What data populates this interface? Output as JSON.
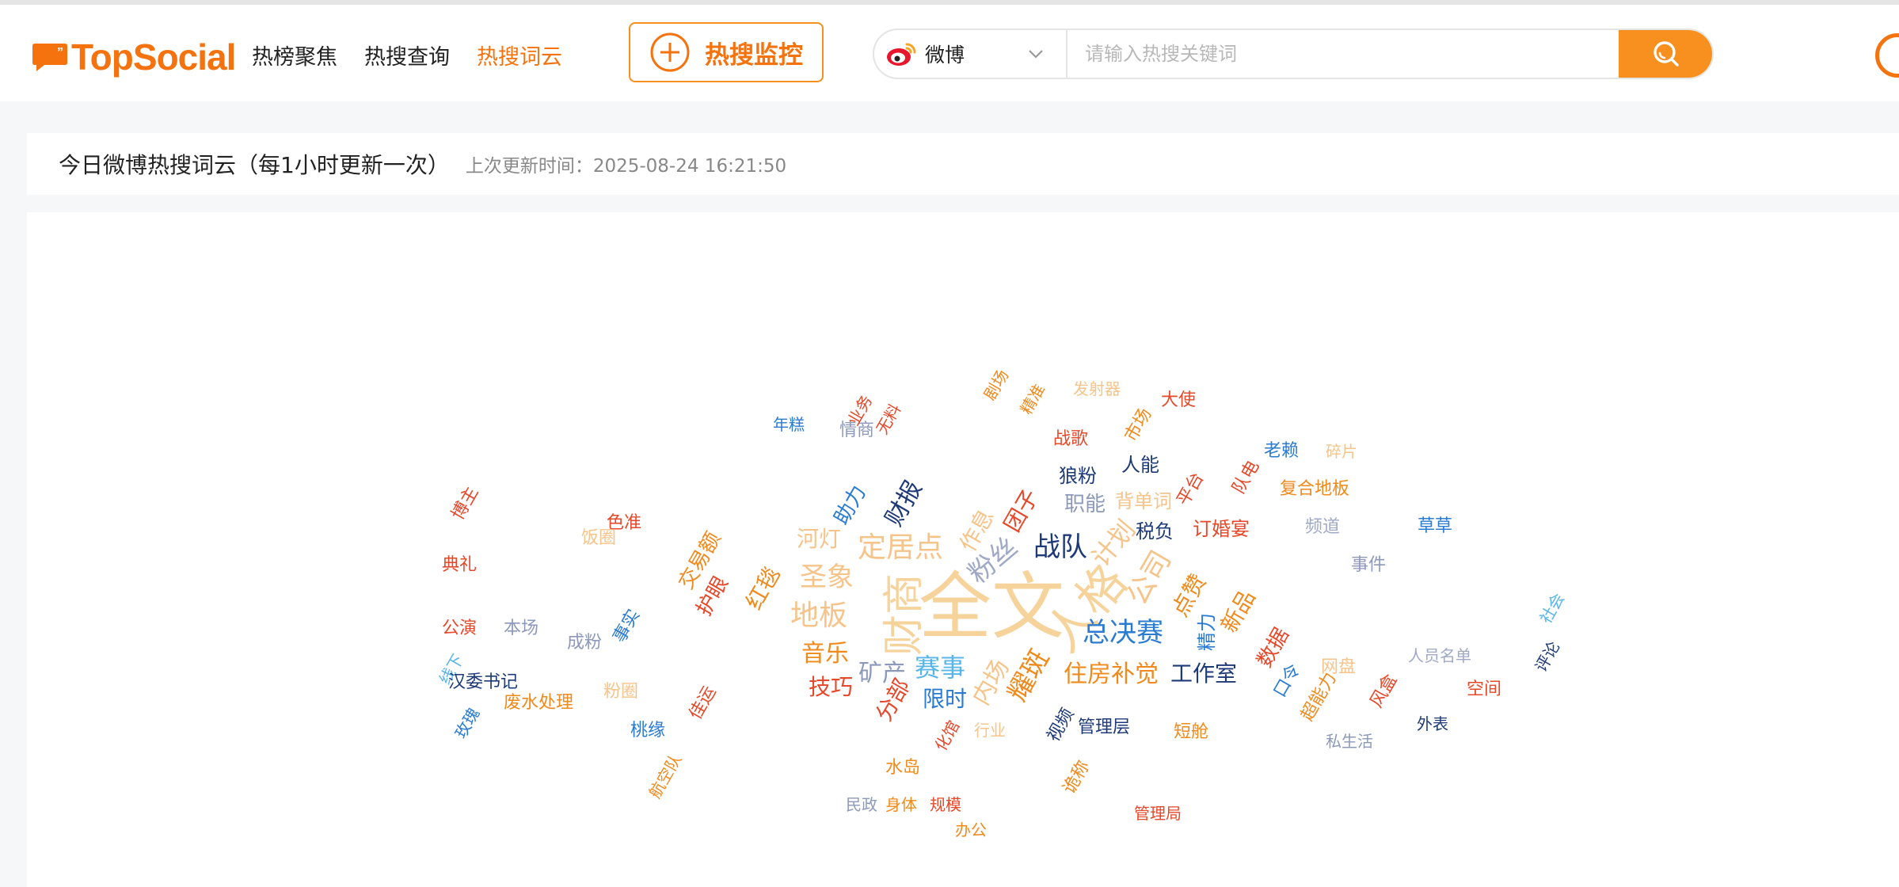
{
  "header": {
    "logo_text": "TopSocial",
    "nav": [
      {
        "label": "热榜聚焦",
        "active": false
      },
      {
        "label": "热搜查询",
        "active": false
      },
      {
        "label": "热搜词云",
        "active": true
      }
    ],
    "monitor_button": "热搜监控",
    "search": {
      "platform": "微博",
      "placeholder": "请输入热搜关键词",
      "value": ""
    }
  },
  "panel": {
    "title": "今日微博热搜词云（每1小时更新一次）",
    "updated": "上次更新时间：2025-08-24 16:21:50"
  },
  "colors": {
    "brand": "#f5730f",
    "accent": "#f7901e"
  },
  "cloud_words": [
    {
      "t": "全文",
      "c": "#f7d39c"
    },
    {
      "t": "财商",
      "c": "#f7d39c"
    },
    {
      "t": "人格",
      "c": "#f7d39c"
    },
    {
      "t": "地板",
      "c": "#f6c48a"
    },
    {
      "t": "圣象",
      "c": "#f6c48a"
    },
    {
      "t": "定居点",
      "c": "#f6c48a"
    },
    {
      "t": "粉丝",
      "c": "#9fa9c6"
    },
    {
      "t": "作息",
      "c": "#f6c48a"
    },
    {
      "t": "战队",
      "c": "#1e3a78"
    },
    {
      "t": "公司",
      "c": "#f6c48a"
    },
    {
      "t": "计划",
      "c": "#f6c48a"
    },
    {
      "t": "总决赛",
      "c": "#2a7bd2"
    },
    {
      "t": "住房补觉",
      "c": "#f08a1d"
    },
    {
      "t": "工作室",
      "c": "#1e3a78"
    },
    {
      "t": "耀斑",
      "c": "#f08a1d"
    },
    {
      "t": "内场",
      "c": "#f6c48a"
    },
    {
      "t": "赛事",
      "c": "#58b5e8"
    },
    {
      "t": "矿产",
      "c": "#8c99bb"
    },
    {
      "t": "音乐",
      "c": "#f08a1d"
    },
    {
      "t": "技巧",
      "c": "#e6482a"
    },
    {
      "t": "限时",
      "c": "#2a7bd2"
    },
    {
      "t": "分部",
      "c": "#e6482a"
    },
    {
      "t": "河灯",
      "c": "#f6c48a"
    },
    {
      "t": "团子",
      "c": "#e6482a"
    },
    {
      "t": "财报",
      "c": "#1e3a78"
    },
    {
      "t": "助力",
      "c": "#2a7bd2"
    },
    {
      "t": "红毯",
      "c": "#f08a1d"
    },
    {
      "t": "护眼",
      "c": "#e6482a"
    },
    {
      "t": "交易额",
      "c": "#f08a1d"
    },
    {
      "t": "点赞",
      "c": "#f08a1d"
    },
    {
      "t": "精力",
      "c": "#2a7bd2"
    },
    {
      "t": "新品",
      "c": "#f08a1d"
    },
    {
      "t": "数据",
      "c": "#e6482a"
    },
    {
      "t": "职能",
      "c": "#8c99bb"
    },
    {
      "t": "狼粉",
      "c": "#1e3a78"
    },
    {
      "t": "人能",
      "c": "#1e3a78"
    },
    {
      "t": "税负",
      "c": "#1e3a78"
    },
    {
      "t": "订婚宴",
      "c": "#e6482a"
    },
    {
      "t": "复合地板",
      "c": "#f08a1d"
    },
    {
      "t": "老赖",
      "c": "#2a7bd2"
    },
    {
      "t": "碎片",
      "c": "#f6c48a"
    },
    {
      "t": "大使",
      "c": "#e6482a"
    },
    {
      "t": "发射器",
      "c": "#f6c48a"
    },
    {
      "t": "背单词",
      "c": "#f6c48a"
    },
    {
      "t": "平台",
      "c": "#e6482a"
    },
    {
      "t": "队电",
      "c": "#e6482a"
    },
    {
      "t": "频道",
      "c": "#9fa9c6"
    },
    {
      "t": "草草",
      "c": "#2a7bd2"
    },
    {
      "t": "事件",
      "c": "#8c99bb"
    },
    {
      "t": "人员名单",
      "c": "#9fa9c6"
    },
    {
      "t": "空间",
      "c": "#e6482a"
    },
    {
      "t": "评论",
      "c": "#1e3a78"
    },
    {
      "t": "社会",
      "c": "#58b5e8"
    },
    {
      "t": "网盘",
      "c": "#f6c48a"
    },
    {
      "t": "口令",
      "c": "#2a7bd2"
    },
    {
      "t": "超能力",
      "c": "#f08a1d"
    },
    {
      "t": "风盒",
      "c": "#e6482a"
    },
    {
      "t": "外表",
      "c": "#1e3a78"
    },
    {
      "t": "私生活",
      "c": "#8c99bb"
    },
    {
      "t": "短舱",
      "c": "#f08a1d"
    },
    {
      "t": "管理局",
      "c": "#e6482a"
    },
    {
      "t": "管理层",
      "c": "#1e3a78"
    },
    {
      "t": "视频",
      "c": "#1e3a78"
    },
    {
      "t": "诡称",
      "c": "#f08a1d"
    },
    {
      "t": "规模",
      "c": "#e6482a"
    },
    {
      "t": "身体",
      "c": "#f08a1d"
    },
    {
      "t": "民政",
      "c": "#8c99bb"
    },
    {
      "t": "办公",
      "c": "#f08a1d"
    },
    {
      "t": "水岛",
      "c": "#f08a1d"
    },
    {
      "t": "行业",
      "c": "#f6c48a"
    },
    {
      "t": "化馆",
      "c": "#e6482a"
    },
    {
      "t": "桃缘",
      "c": "#2a7bd2"
    },
    {
      "t": "航空队",
      "c": "#f08a1d"
    },
    {
      "t": "粉圈",
      "c": "#f6c48a"
    },
    {
      "t": "佳运",
      "c": "#e6482a"
    },
    {
      "t": "事实",
      "c": "#2a7bd2"
    },
    {
      "t": "成粉",
      "c": "#8c99bb"
    },
    {
      "t": "本场",
      "c": "#8c99bb"
    },
    {
      "t": "公演",
      "c": "#e6482a"
    },
    {
      "t": "线下",
      "c": "#58b5e8"
    },
    {
      "t": "典礼",
      "c": "#e6482a"
    },
    {
      "t": "博主",
      "c": "#e6482a"
    },
    {
      "t": "色准",
      "c": "#e6482a"
    },
    {
      "t": "饭圈",
      "c": "#f6c48a"
    },
    {
      "t": "汉委书记",
      "c": "#1e3a78"
    },
    {
      "t": "废水处理",
      "c": "#f08a1d"
    },
    {
      "t": "玫瑰",
      "c": "#2a7bd2"
    },
    {
      "t": "年糕",
      "c": "#2a7bd2"
    },
    {
      "t": "情商",
      "c": "#8c99bb"
    },
    {
      "t": "业务",
      "c": "#e6482a"
    },
    {
      "t": "无料",
      "c": "#e6482a"
    },
    {
      "t": "剧场",
      "c": "#f08a1d"
    },
    {
      "t": "精准",
      "c": "#f08a1d"
    },
    {
      "t": "战歌",
      "c": "#e6482a"
    },
    {
      "t": "市场",
      "c": "#f08a1d"
    }
  ]
}
